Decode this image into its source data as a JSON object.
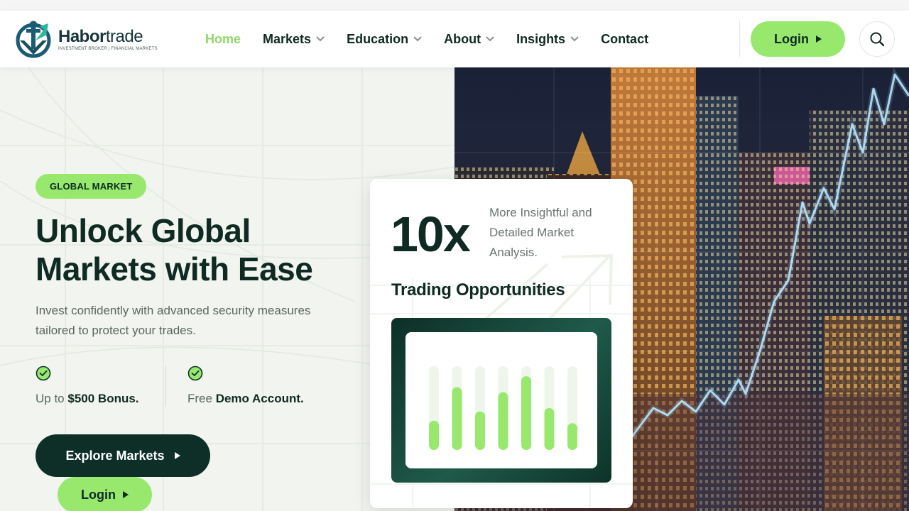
{
  "header": {
    "logo": {
      "name_bold": "Habor",
      "name_light": "trade",
      "tagline": "INVESTMENT BROKER | FINANCIAL MARKETS"
    },
    "nav": [
      {
        "label": "Home",
        "active": true,
        "dropdown": false
      },
      {
        "label": "Markets",
        "active": false,
        "dropdown": true
      },
      {
        "label": "Education",
        "active": false,
        "dropdown": true
      },
      {
        "label": "About",
        "active": false,
        "dropdown": true
      },
      {
        "label": "Insights",
        "active": false,
        "dropdown": true
      },
      {
        "label": "Contact",
        "active": false,
        "dropdown": false
      }
    ],
    "login_label": "Login",
    "search_icon": "search-icon"
  },
  "hero": {
    "badge": "GLOBAL MARKET",
    "title": "Unlock Global Markets with Ease",
    "subtitle": "Invest confidently with advanced security measures tailored to protect your trades.",
    "features": [
      {
        "prefix": "Up to",
        "highlight": "$500 Bonus."
      },
      {
        "prefix": "Free",
        "highlight": "Demo Account."
      }
    ],
    "explore_label": "Explore Markets",
    "login_label": "Login"
  },
  "card": {
    "big_number": "10x",
    "description": "More Insightful and Detailed Market Analysis.",
    "heading": "Trading Opportunities",
    "bar_levels": [
      0.35,
      0.75,
      0.46,
      0.69,
      0.88,
      0.5,
      0.32
    ]
  },
  "colors": {
    "accent": "#98e86e",
    "dark": "#0d2f27",
    "text": "#0e2a22",
    "muted": "#5b6660"
  }
}
